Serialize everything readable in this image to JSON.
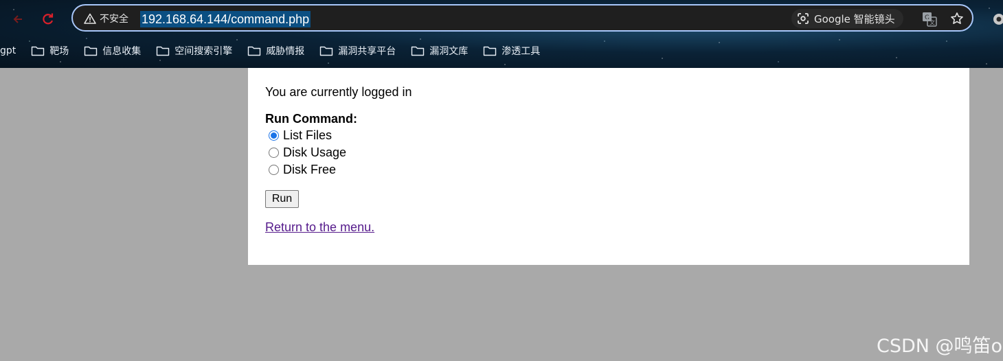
{
  "browser": {
    "security_label": "不安全",
    "url": "192.168.64.144/command.php",
    "lens_label": "Google 智能镜头",
    "bookmarks": [
      {
        "label": "gpt",
        "icon": "none"
      },
      {
        "label": "靶场",
        "icon": "folder-icon"
      },
      {
        "label": "信息收集",
        "icon": "folder-icon"
      },
      {
        "label": "空间搜索引擎",
        "icon": "folder-icon"
      },
      {
        "label": "威胁情报",
        "icon": "folder-icon"
      },
      {
        "label": "漏洞共享平台",
        "icon": "folder-icon"
      },
      {
        "label": "漏洞文库",
        "icon": "folder-icon"
      },
      {
        "label": "渗透工具",
        "icon": "folder-icon"
      }
    ],
    "colors": {
      "omnibox_border": "#a8c7fa",
      "url_highlight": "#0b4f82"
    }
  },
  "page": {
    "login_status": "You are currently logged in",
    "heading": "Run Command:",
    "options": [
      {
        "label": "List Files",
        "checked": true
      },
      {
        "label": "Disk Usage",
        "checked": false
      },
      {
        "label": "Disk Free",
        "checked": false
      }
    ],
    "run_label": "Run",
    "return_link": "Return to the menu.",
    "colors": {
      "background": "#a9a9a9",
      "card": "#ffffff",
      "link_visited": "#551a8b"
    }
  },
  "watermark": "CSDN @鸣笛o"
}
